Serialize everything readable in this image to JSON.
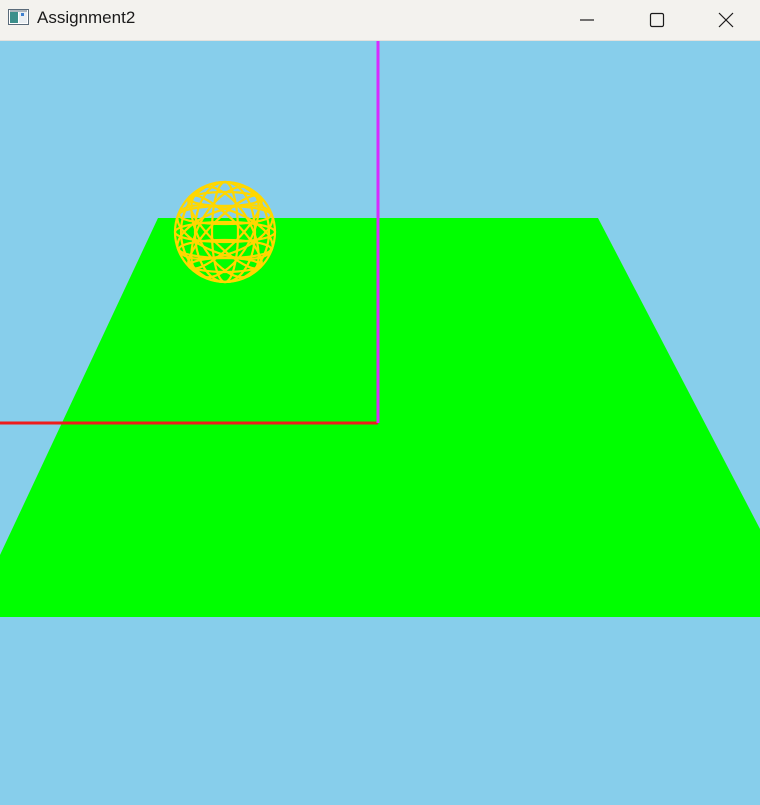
{
  "window": {
    "title": "Assignment2",
    "app_icon": "application-window-icon",
    "controls": {
      "minimize_icon": "minimize-icon",
      "maximize_icon": "maximize-icon",
      "close_icon": "close-icon"
    }
  },
  "scene": {
    "sky_color": "#87ceeb",
    "ground_color": "#00ff00",
    "sphere_color": "#ffd700",
    "sphere_style": "wireframe",
    "x_axis_color": "#ee1c1c",
    "y_axis_color": "#d82aff"
  }
}
